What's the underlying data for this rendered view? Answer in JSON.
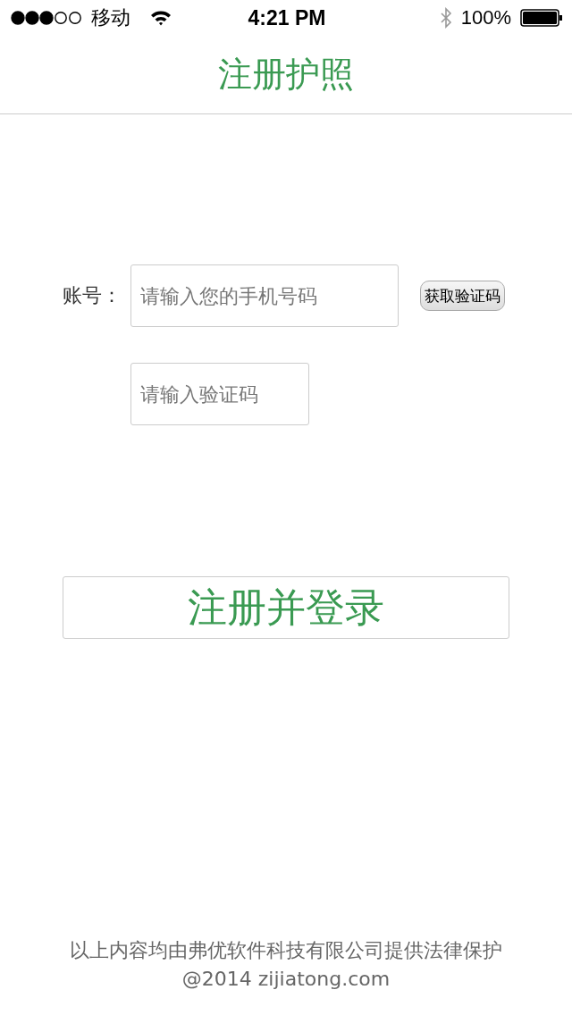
{
  "status_bar": {
    "carrier": "移动",
    "time": "4:21 PM",
    "battery": "100%"
  },
  "nav_bar": {
    "title": "注册护照"
  },
  "form": {
    "account_label": "账号：",
    "phone_field": {
      "placeholder": "请输入您的手机号码"
    },
    "code_button": "获取验证码",
    "code_field": {
      "placeholder": "请输入验证码"
    },
    "submit_button": "注册并登录"
  },
  "footer": {
    "lines": [
      "以上内容均由弗优软件科技有限公司提供法律保护",
      "@2014 zijiatong.com"
    ]
  }
}
